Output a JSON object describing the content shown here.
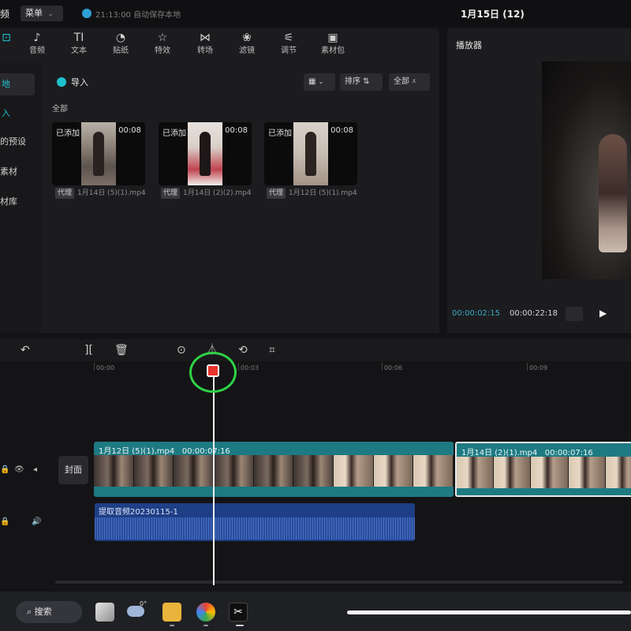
{
  "header": {
    "app_fragment": "频",
    "menu_label": "菜单",
    "menu_caret": "⌄",
    "autosave_text": "21:13:00 自动保存本地",
    "project_title": "1月15日 (12)"
  },
  "toolbar": {
    "tools": [
      {
        "label": "",
        "icon": "media-icon",
        "glyph": "⊡"
      },
      {
        "label": "音频",
        "icon": "audio-icon",
        "glyph": "♪"
      },
      {
        "label": "文本",
        "icon": "text-icon",
        "glyph": "TI"
      },
      {
        "label": "贴纸",
        "icon": "sticker-icon",
        "glyph": "◔"
      },
      {
        "label": "特效",
        "icon": "effects-icon",
        "glyph": "☆"
      },
      {
        "label": "转场",
        "icon": "transition-icon",
        "glyph": "⋈"
      },
      {
        "label": "滤镜",
        "icon": "filter-icon",
        "glyph": "❀"
      },
      {
        "label": "调节",
        "icon": "adjust-icon",
        "glyph": "⚟"
      },
      {
        "label": "素材包",
        "icon": "package-icon",
        "glyph": "▣"
      }
    ]
  },
  "sidebar": {
    "items": [
      {
        "label": "地",
        "active": true
      },
      {
        "label": "入",
        "active": false,
        "accent": true
      },
      {
        "label": "的预设",
        "active": false
      },
      {
        "label": "素材",
        "active": false
      },
      {
        "label": "材库",
        "active": false
      }
    ]
  },
  "media": {
    "import_label": "导入",
    "sort_label": "排序",
    "filter_label": "全部",
    "section_label": "全部",
    "clips": [
      {
        "added": "已添加",
        "duration": "00:08",
        "proxy": "代理",
        "name": "1月14日 (5)(1).mp4"
      },
      {
        "added": "已添加",
        "duration": "00:08",
        "proxy": "代理",
        "name": "1月14日 (2)(2).mp4"
      },
      {
        "added": "已添加",
        "duration": "00:08",
        "proxy": "代理",
        "name": "1月12日 (5)(1).mp4"
      }
    ]
  },
  "player": {
    "title": "播放器",
    "current_time": "00:00:02:15",
    "total_time": "00:00:22:18"
  },
  "timeline": {
    "ruler": [
      "00:00",
      "00:03",
      "00:06",
      "00:09"
    ],
    "cover_label": "封面",
    "video_clips": [
      {
        "name": "1月12日 (5)(1).mp4",
        "duration": "00:00:07:16",
        "selected": false
      },
      {
        "name": "1月14日 (2)(1).mp4",
        "duration": "00:00:07:16",
        "selected": true
      }
    ],
    "audio_clip": {
      "name": "提取音频20230115-1"
    }
  },
  "taskbar": {
    "search_label": "搜索",
    "weather": "0°"
  },
  "colors": {
    "accent": "#1fc1cf",
    "video_track": "#1e7a82",
    "audio_track": "#1e3e86",
    "playhead_marker": "#e8342c",
    "highlight_ring": "#2fd246"
  }
}
